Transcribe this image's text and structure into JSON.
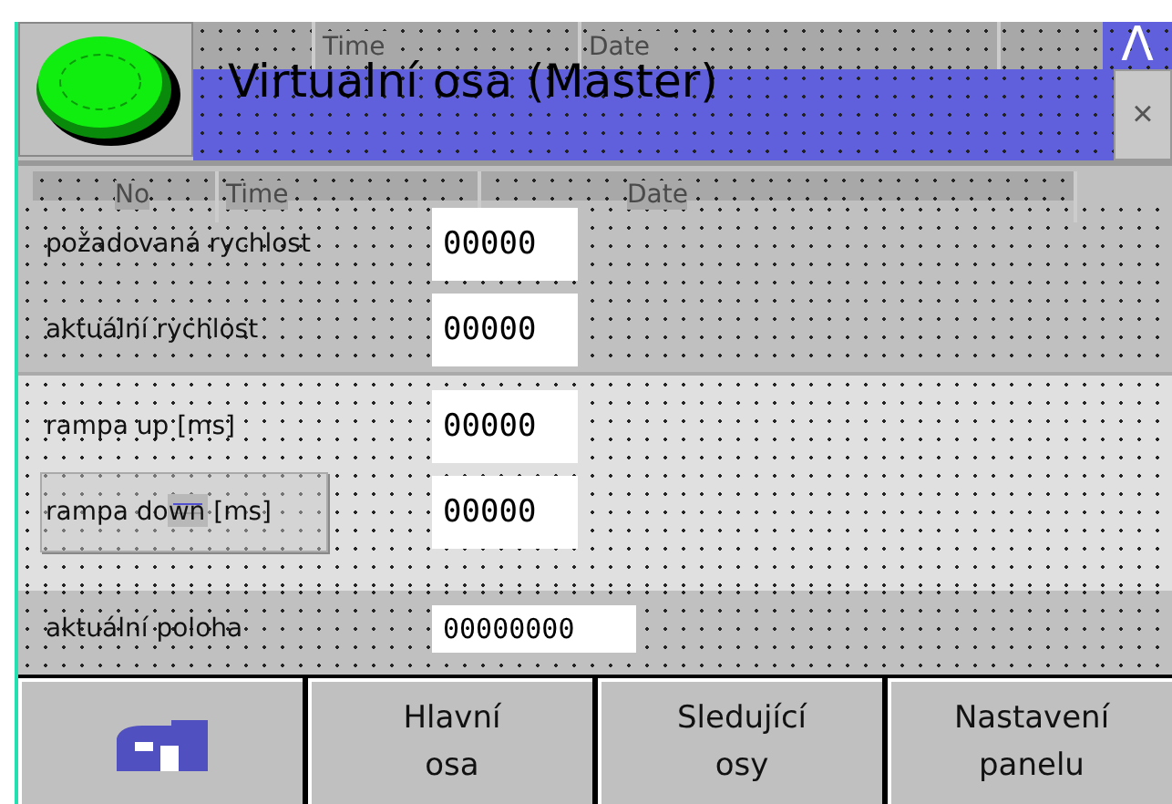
{
  "header": {
    "title": "Virtualní osa (Master)",
    "columns": [
      "Time",
      "Date"
    ],
    "alarm_button": "Λ",
    "close_button": "×"
  },
  "panel": {
    "columns": [
      "No",
      "Time",
      "Date"
    ],
    "speeds": [
      {
        "label": "požadovaná rychlost",
        "value": "00000"
      },
      {
        "label": "aktuální rychlost",
        "value": "00000"
      }
    ],
    "ramps": [
      {
        "label": "rampa up [ms]",
        "value": "00000",
        "kind": "plain"
      },
      {
        "label": "rampa down [ms]",
        "value": "00000",
        "kind": "framed"
      }
    ]
  },
  "position": {
    "label": "aktuální poloha",
    "value": "00000000"
  },
  "nav": [
    {
      "kind": "icon"
    },
    {
      "kind": "text",
      "label": "Hlavní\nosa"
    },
    {
      "kind": "text",
      "label": "Sledující\nosy"
    },
    {
      "kind": "text",
      "label": "Nastavení\npanelu"
    }
  ]
}
